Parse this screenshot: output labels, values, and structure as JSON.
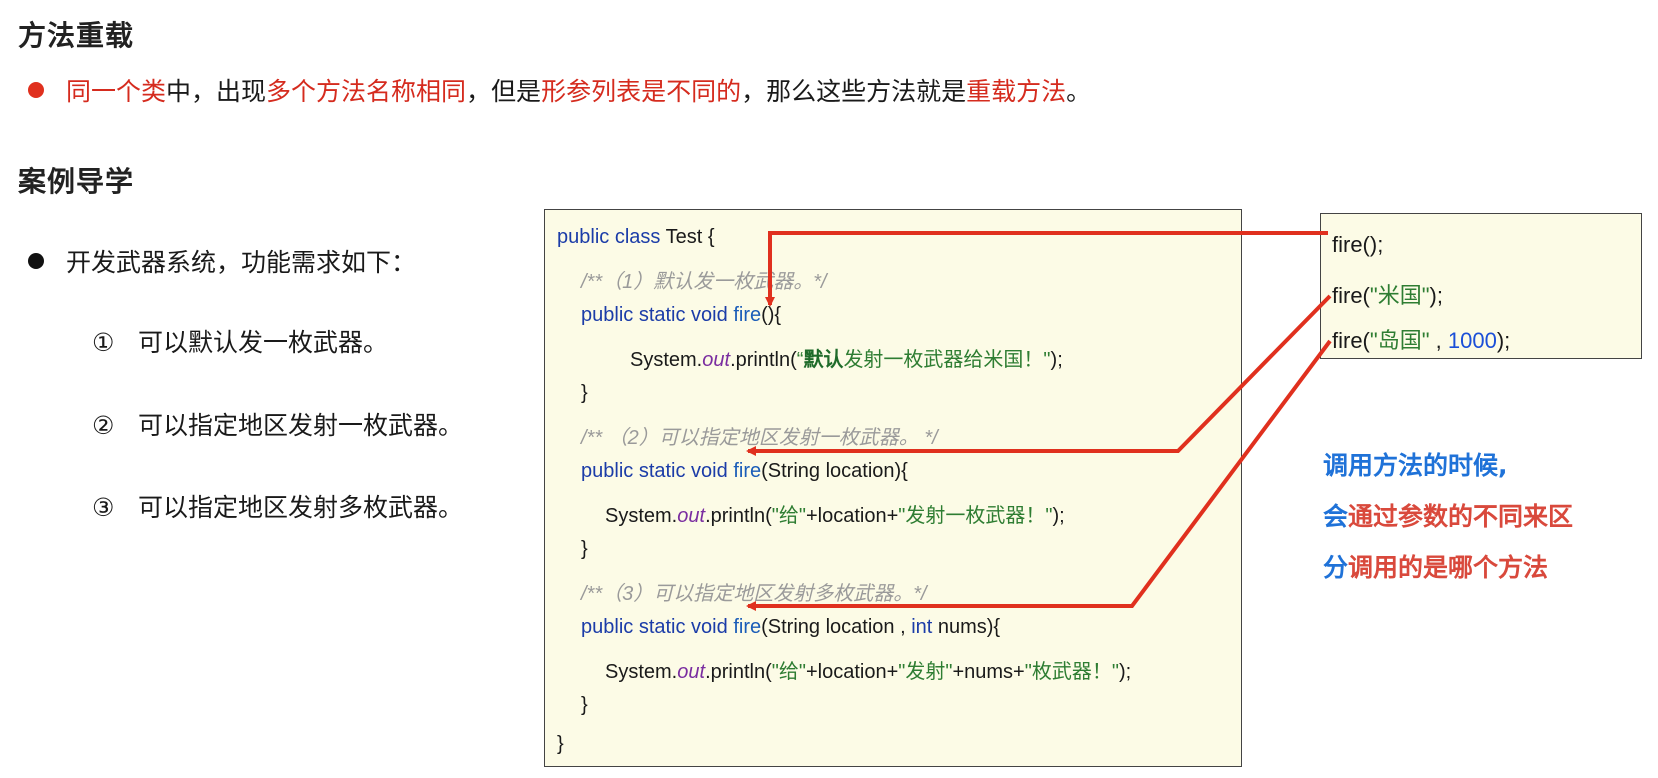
{
  "headings": {
    "overload": "方法重载",
    "case": "案例导学"
  },
  "definition": {
    "p1": "同一个类",
    "p2": "中，出现",
    "p3": "多个方法名称相同",
    "p4": "，但是",
    "p5": "形参列表是不同的",
    "p6": "，那么这些方法就是",
    "p7": "重载方法",
    "p8": "。"
  },
  "requirements": {
    "intro": "开发武器系统，功能需求如下：",
    "items": [
      {
        "num": "①",
        "text": "可以默认发一枚武器。"
      },
      {
        "num": "②",
        "text": "可以指定地区发射一枚武器。"
      },
      {
        "num": "③",
        "text": "可以指定地区发射多枚武器。"
      }
    ]
  },
  "code": {
    "l1_kw": "public class",
    "l1_rest": " Test {",
    "c1": "/**（1）默认发一枚武器。*/",
    "m_kw": "public static void",
    "fn": "fire",
    "m1_sig": "(){",
    "sys": "System.",
    "out": "out",
    "println": ".println(",
    "s1_open": "“",
    "s1_bold": "默认",
    "s1_rest": "发射一枚武器给米国！\"",
    "close_paren": ");",
    "brace": "}",
    "c2": "/** （2）可以指定地区发射一枚武器。 */",
    "m2_sig": "(String location){",
    "s2a": "\"给\"",
    "plus_loc": "+location+",
    "s2b": "\"发射一枚武器！\"",
    "c3": "/**（3）可以指定地区发射多枚武器。*/",
    "m3_sig_a": "(String location , ",
    "int_kw": "int",
    "m3_sig_b": " nums){",
    "s3b": "\"发射\"",
    "plus_nums": "+nums+",
    "s3c": "\"枚武器！\"",
    "final_brace": "}"
  },
  "calls": {
    "c1": "fire();",
    "c2_a": "fire(",
    "c2_s": "\"米国\"",
    "c2_b": ");",
    "c3_a": "fire(",
    "c3_s": "\"岛国\"",
    "c3_sep": " , ",
    "c3_n": "1000",
    "c3_b": ");"
  },
  "note": {
    "l1": "调用方法的时候,",
    "l2_a": "会",
    "l2_b": "通过参数的不同来区",
    "l3_a": "分",
    "l3_b": "调用的是哪个方法"
  },
  "colors": {
    "red": "#d52b1e",
    "keyword_blue": "#1b3ca8",
    "code_bg": "#fcfbe6",
    "arrow_red": "#e0301e"
  }
}
